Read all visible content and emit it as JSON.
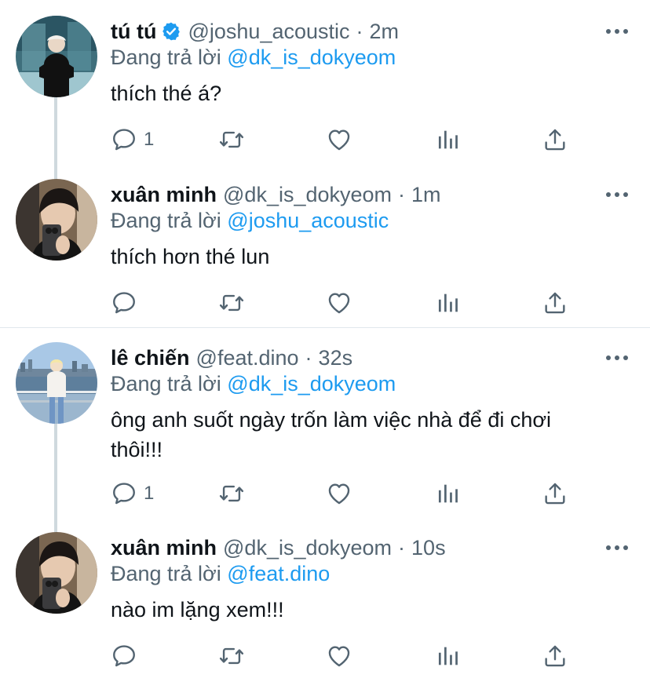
{
  "colors": {
    "accent": "#1d9bf0",
    "text": "#0f1419",
    "muted": "#536471",
    "line": "#cfd9de"
  },
  "tweets": [
    {
      "name": "tú tú",
      "verified": true,
      "handle": "@joshu_acoustic",
      "sep": "·",
      "time": "2m",
      "reply_prefix": "Đang trả lời",
      "reply_to": "@dk_is_dokyeom",
      "text": "thích thé á?",
      "reply_count": "1",
      "icons": [
        "reply-icon",
        "retweet-icon",
        "like-icon",
        "analytics-icon",
        "share-icon"
      ]
    },
    {
      "name": "xuân minh",
      "verified": false,
      "handle": "@dk_is_dokyeom",
      "sep": "·",
      "time": "1m",
      "reply_prefix": "Đang trả lời",
      "reply_to": "@joshu_acoustic",
      "text": "thích hơn thé lun",
      "reply_count": "",
      "icons": [
        "reply-icon",
        "retweet-icon",
        "like-icon",
        "analytics-icon",
        "share-icon"
      ]
    },
    {
      "name": "lê chiến",
      "verified": false,
      "handle": "@feat.dino",
      "sep": "·",
      "time": "32s",
      "reply_prefix": "Đang trả lời",
      "reply_to": "@dk_is_dokyeom",
      "text_line1": "ông anh suốt ngày trốn làm việc nhà để đi chơi",
      "text_line2": "thôi!!!",
      "reply_count": "1",
      "icons": [
        "reply-icon",
        "retweet-icon",
        "like-icon",
        "analytics-icon",
        "share-icon"
      ]
    },
    {
      "name": "xuân minh",
      "verified": false,
      "handle": "@dk_is_dokyeom",
      "sep": "·",
      "time": "10s",
      "reply_prefix": "Đang trả lời",
      "reply_to": "@feat.dino",
      "text": "nào im lặng xem!!!",
      "reply_count": "",
      "icons": [
        "reply-icon",
        "retweet-icon",
        "like-icon",
        "analytics-icon",
        "share-icon"
      ]
    }
  ]
}
